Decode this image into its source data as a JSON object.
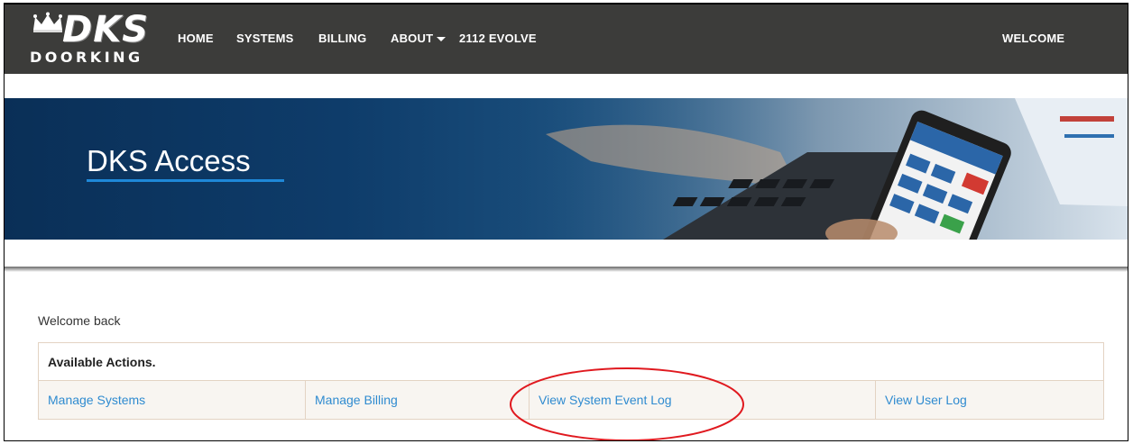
{
  "brand": {
    "mark": "DKS",
    "wordmark": "DOORKING"
  },
  "nav": {
    "home": "HOME",
    "systems": "SYSTEMS",
    "billing": "BILLING",
    "about": "ABOUT",
    "evolve": "2112 EVOLVE",
    "welcome": "WELCOME"
  },
  "hero": {
    "title": "DKS Access"
  },
  "main": {
    "welcome_text": "Welcome back",
    "actions_title": "Available Actions.",
    "actions": [
      {
        "label": "Manage Systems"
      },
      {
        "label": "Manage Billing"
      },
      {
        "label": "View System Event Log"
      },
      {
        "label": "View User Log"
      }
    ]
  },
  "colors": {
    "navbar": "#3c3c3a",
    "hero_dark": "#0a2f57",
    "link": "#2f8bd0",
    "highlight_ellipse": "#e0191f",
    "table_border": "#e3d3c3"
  },
  "icons": [
    "crown-icon",
    "caret-down-icon"
  ]
}
